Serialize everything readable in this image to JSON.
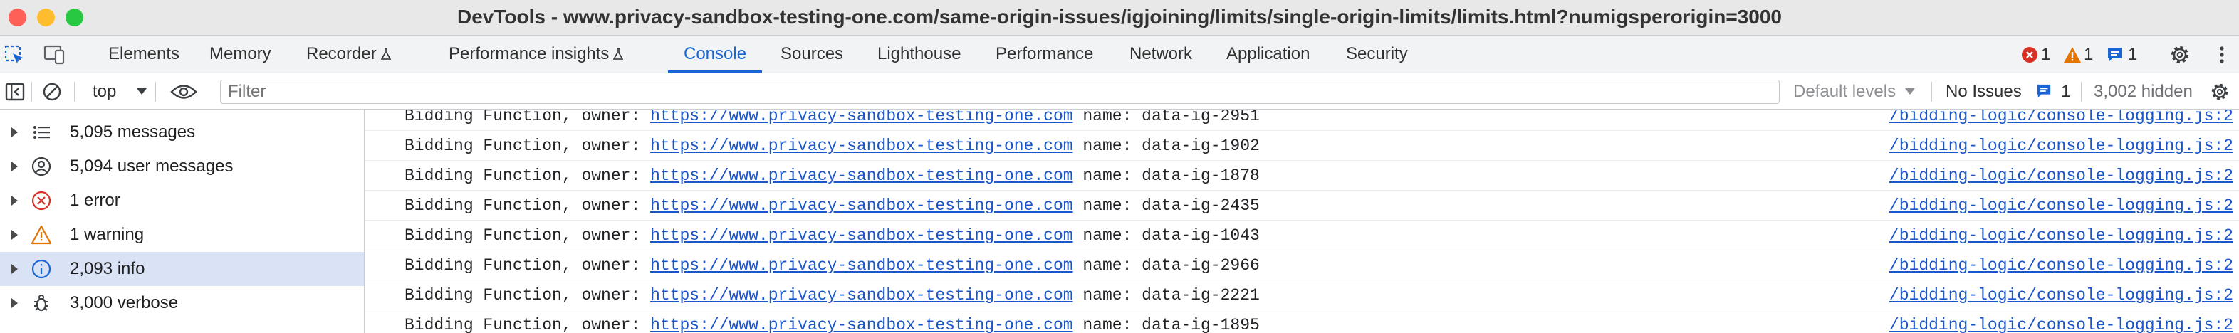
{
  "window": {
    "title": "DevTools - www.privacy-sandbox-testing-one.com/same-origin-issues/igjoining/limits/single-origin-limits/limits.html?numigsperorigin=3000"
  },
  "tabs": [
    {
      "label": "Elements",
      "active": false
    },
    {
      "label": "Memory",
      "active": false
    },
    {
      "label": "Recorder",
      "active": false,
      "experimental": true
    },
    {
      "label": "Performance insights",
      "active": false,
      "experimental": true
    },
    {
      "label": "Console",
      "active": true
    },
    {
      "label": "Sources",
      "active": false
    },
    {
      "label": "Lighthouse",
      "active": false
    },
    {
      "label": "Performance",
      "active": false
    },
    {
      "label": "Network",
      "active": false
    },
    {
      "label": "Application",
      "active": false
    },
    {
      "label": "Security",
      "active": false
    }
  ],
  "status_counts": {
    "errors": "1",
    "warnings": "1",
    "messages": "1"
  },
  "toolbar": {
    "context": "top",
    "filter_placeholder": "Filter",
    "default_levels": "Default levels",
    "no_issues": "No Issues",
    "issues_count": "1",
    "hidden": "3,002 hidden"
  },
  "sidebar": {
    "items": [
      {
        "label": "5,095 messages",
        "icon": "list-icon"
      },
      {
        "label": "5,094 user messages",
        "icon": "user-icon"
      },
      {
        "label": "1 error",
        "icon": "error-icon"
      },
      {
        "label": "1 warning",
        "icon": "warning-icon"
      },
      {
        "label": "2,093 info",
        "icon": "info-icon",
        "selected": true
      },
      {
        "label": "3,000 verbose",
        "icon": "bug-icon"
      }
    ]
  },
  "console": {
    "prefix": "Bidding Function, owner: ",
    "owner_url": "https://www.privacy-sandbox-testing-one.com",
    "source": "/bidding-logic/console-logging.js:2",
    "rows": [
      {
        "name": " name: data-ig-2951"
      },
      {
        "name": " name: data-ig-1902"
      },
      {
        "name": " name: data-ig-1878"
      },
      {
        "name": " name: data-ig-2435"
      },
      {
        "name": " name: data-ig-1043"
      },
      {
        "name": " name: data-ig-2966"
      },
      {
        "name": " name: data-ig-2221"
      },
      {
        "name": " name: data-ig-1895"
      }
    ]
  },
  "colors": {
    "accent": "#1a65d6",
    "error": "#d93025",
    "warning": "#e37400",
    "selected_bg": "#dae3f5"
  }
}
